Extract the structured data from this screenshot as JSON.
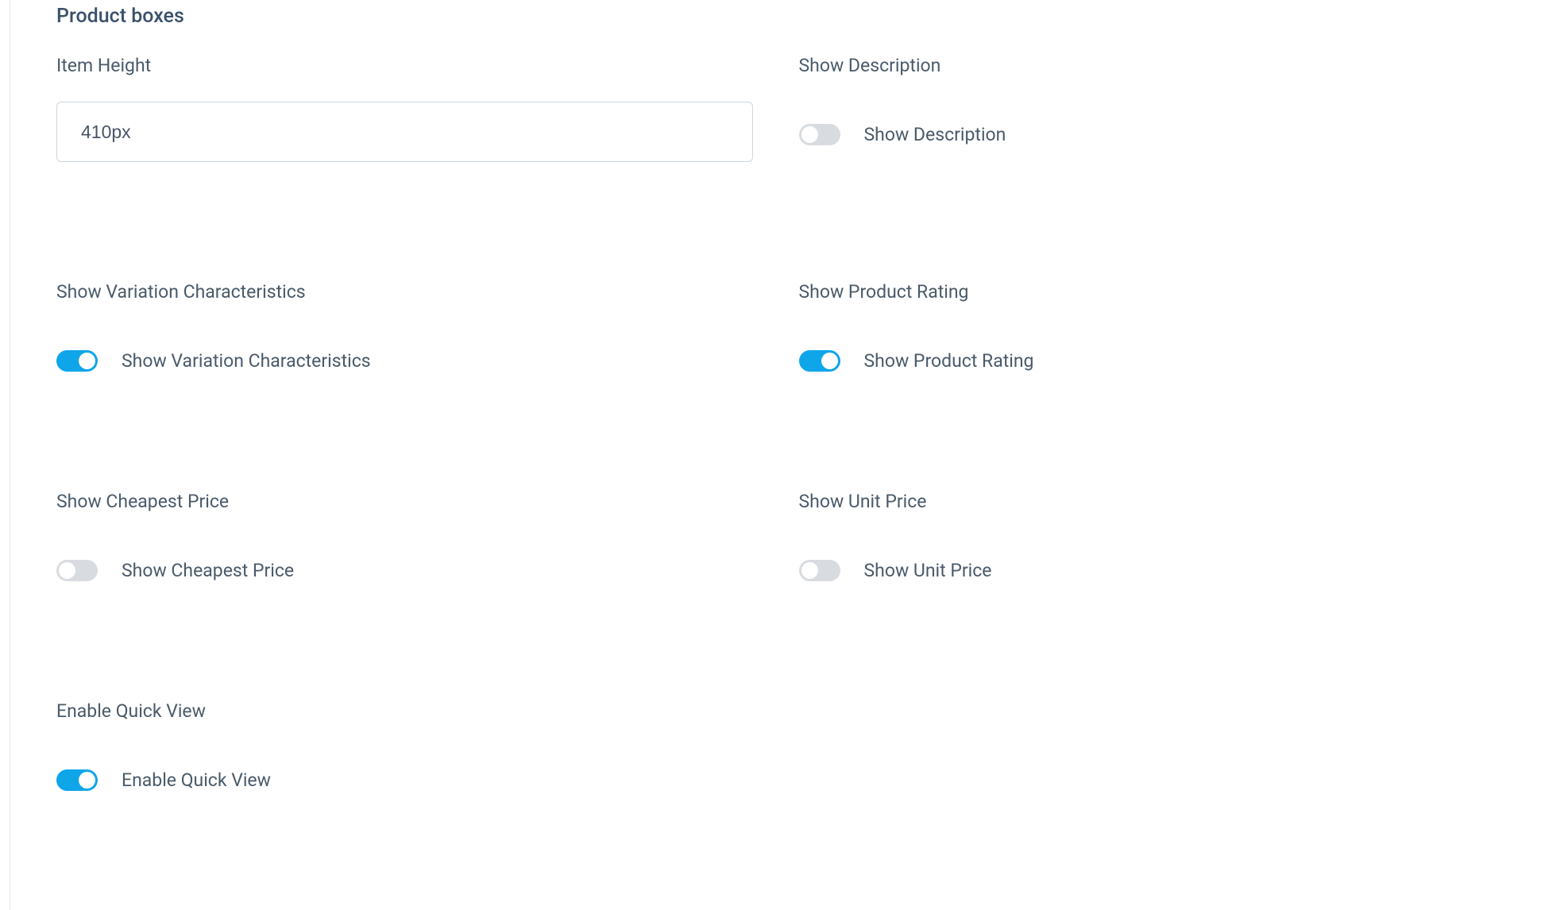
{
  "section": {
    "title": "Product boxes"
  },
  "fields": {
    "itemHeight": {
      "label": "Item Height",
      "value": "410px"
    },
    "showDescription": {
      "label": "Show Description",
      "toggleLabel": "Show Description",
      "enabled": false
    },
    "showVariationCharacteristics": {
      "label": "Show Variation Characteristics",
      "toggleLabel": "Show Variation Characteristics",
      "enabled": true
    },
    "showProductRating": {
      "label": "Show Product Rating",
      "toggleLabel": "Show Product Rating",
      "enabled": true
    },
    "showCheapestPrice": {
      "label": "Show Cheapest Price",
      "toggleLabel": "Show Cheapest Price",
      "enabled": false
    },
    "showUnitPrice": {
      "label": "Show Unit Price",
      "toggleLabel": "Show Unit Price",
      "enabled": false
    },
    "enableQuickView": {
      "label": "Enable Quick View",
      "toggleLabel": "Enable Quick View",
      "enabled": true
    }
  }
}
